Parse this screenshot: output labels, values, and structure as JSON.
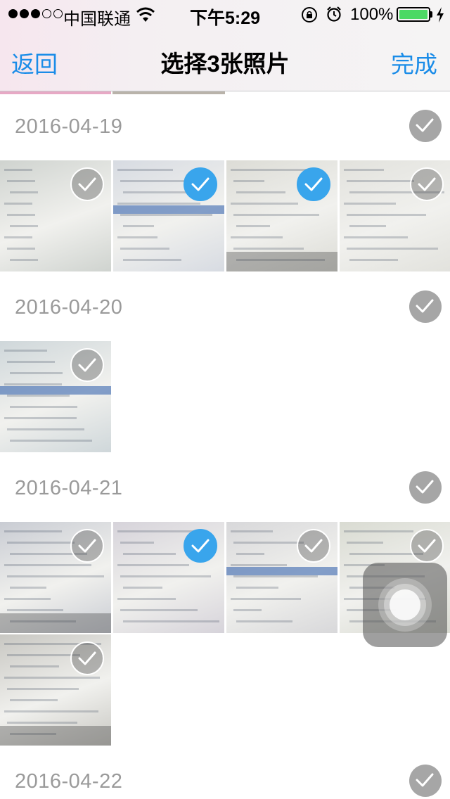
{
  "status_bar": {
    "carrier": "中国联通",
    "time": "下午5:29",
    "battery": "100%"
  },
  "nav": {
    "back_label": "返回",
    "title": "选择3张照片",
    "done_label": "完成"
  },
  "sections": [
    {
      "date": "2016-04-19",
      "photos": [
        {
          "selected": false,
          "tone": "#cfd3cf"
        },
        {
          "selected": true,
          "tone": "#d7dbe2"
        },
        {
          "selected": true,
          "tone": "#dcdcd6"
        },
        {
          "selected": false,
          "tone": "#e2e2dd"
        }
      ]
    },
    {
      "date": "2016-04-20",
      "photos": [
        {
          "selected": false,
          "tone": "#cfd7da"
        }
      ]
    },
    {
      "date": "2016-04-21",
      "photos": [
        {
          "selected": false,
          "tone": "#c9ccd3"
        },
        {
          "selected": true,
          "tone": "#d6d3da"
        },
        {
          "selected": false,
          "tone": "#d8d8da"
        },
        {
          "selected": false,
          "tone": "#d9dbd2"
        },
        {
          "selected": false,
          "tone": "#c8c7c2"
        }
      ]
    },
    {
      "date": "2016-04-22",
      "photos": []
    }
  ],
  "colors": {
    "accent": "#1a8ce8",
    "selected_check": "#39a5ec",
    "date_text": "#9a9a9a"
  }
}
